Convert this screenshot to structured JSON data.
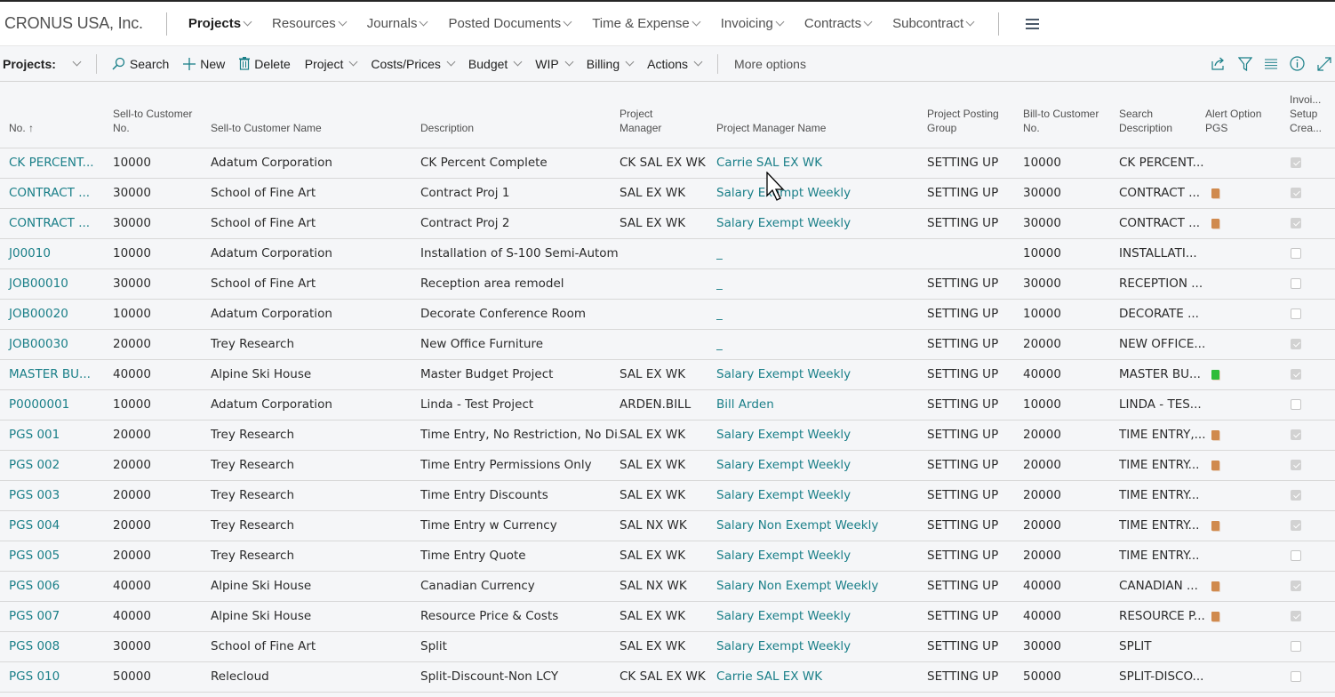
{
  "app": {
    "company": "CRONUS USA, Inc.",
    "nav": [
      {
        "label": "Projects",
        "active": true
      },
      {
        "label": "Resources"
      },
      {
        "label": "Journals"
      },
      {
        "label": "Posted Documents"
      },
      {
        "label": "Time & Expense"
      },
      {
        "label": "Invoicing"
      },
      {
        "label": "Contracts"
      },
      {
        "label": "Subcontract"
      }
    ],
    "menu_icon": "hamburger-icon"
  },
  "toolbar": {
    "title": "Projects:",
    "search_label": "Search",
    "new_label": "New",
    "delete_label": "Delete",
    "project_label": "Project",
    "costs_prices_label": "Costs/Prices",
    "budget_label": "Budget",
    "wip_label": "WIP",
    "billing_label": "Billing",
    "actions_label": "Actions",
    "more_options_label": "More options",
    "right_icons": [
      "share-icon",
      "filter-icon",
      "list-view-icon",
      "info-icon",
      "expand-icon"
    ]
  },
  "colors": {
    "link": "#1a7f88",
    "alert_orange": "#d08a4e",
    "alert_green": "#2ebd3a"
  },
  "table": {
    "columns": [
      "No. ↑",
      "Sell-to Customer No.",
      "Sell-to Customer Name",
      "Description",
      "Project Manager",
      "Project Manager Name",
      "Project Posting Group",
      "Bill-to Customer No.",
      "Search Description",
      "Alert Option PGS",
      "Invoi... Setup Crea..."
    ],
    "rows": [
      {
        "no": "CK PERCENT...",
        "sell_no": "10000",
        "sell_name": "Adatum Corporation",
        "desc": "CK Percent Complete",
        "pm": "CK SAL EX WK",
        "pm_name": "Carrie SAL EX WK",
        "posting": "SETTING UP",
        "bill_no": "10000",
        "search": "CK PERCENT...",
        "alert": "",
        "invoiced": true
      },
      {
        "no": "CONTRACT ...",
        "sell_no": "30000",
        "sell_name": "School of Fine Art",
        "desc": "Contract Proj 1",
        "pm": "SAL EX WK",
        "pm_name": "Salary Exempt Weekly",
        "posting": "SETTING UP",
        "bill_no": "30000",
        "search": "CONTRACT ...",
        "alert": "orange",
        "invoiced": true
      },
      {
        "no": "CONTRACT ...",
        "sell_no": "30000",
        "sell_name": "School of Fine Art",
        "desc": "Contract Proj 2",
        "pm": "SAL EX WK",
        "pm_name": "Salary Exempt Weekly",
        "posting": "SETTING UP",
        "bill_no": "30000",
        "search": "CONTRACT ...",
        "alert": "orange",
        "invoiced": true
      },
      {
        "no": "J00010",
        "sell_no": "10000",
        "sell_name": "Adatum Corporation",
        "desc": "Installation of S-100 Semi-Autom...",
        "pm": "",
        "pm_name": "_",
        "posting": "",
        "bill_no": "10000",
        "search": "INSTALLATI...",
        "alert": "",
        "invoiced": false
      },
      {
        "no": "JOB00010",
        "sell_no": "30000",
        "sell_name": "School of Fine Art",
        "desc": "Reception area remodel",
        "pm": "",
        "pm_name": "_",
        "posting": "SETTING UP",
        "bill_no": "30000",
        "search": "RECEPTION ...",
        "alert": "",
        "invoiced": false
      },
      {
        "no": "JOB00020",
        "sell_no": "10000",
        "sell_name": "Adatum Corporation",
        "desc": "Decorate Conference Room",
        "pm": "",
        "pm_name": "_",
        "posting": "SETTING UP",
        "bill_no": "10000",
        "search": "DECORATE ...",
        "alert": "",
        "invoiced": false
      },
      {
        "no": "JOB00030",
        "sell_no": "20000",
        "sell_name": "Trey Research",
        "desc": "New Office Furniture",
        "pm": "",
        "pm_name": "_",
        "posting": "SETTING UP",
        "bill_no": "20000",
        "search": "NEW OFFICE...",
        "alert": "",
        "invoiced": true
      },
      {
        "no": "MASTER BU...",
        "sell_no": "40000",
        "sell_name": "Alpine Ski House",
        "desc": "Master Budget Project",
        "pm": "SAL EX WK",
        "pm_name": "Salary Exempt Weekly",
        "posting": "SETTING UP",
        "bill_no": "40000",
        "search": "MASTER BU...",
        "alert": "green",
        "invoiced": true
      },
      {
        "no": "P0000001",
        "sell_no": "10000",
        "sell_name": "Adatum Corporation",
        "desc": "Linda - Test Project",
        "pm": "ARDEN.BILL",
        "pm_name": "Bill Arden",
        "posting": "SETTING UP",
        "bill_no": "10000",
        "search": "LINDA - TES...",
        "alert": "",
        "invoiced": false
      },
      {
        "no": "PGS 001",
        "sell_no": "20000",
        "sell_name": "Trey Research",
        "desc": "Time Entry, No Restriction, No Di...",
        "pm": "SAL EX WK",
        "pm_name": "Salary Exempt Weekly",
        "posting": "SETTING UP",
        "bill_no": "20000",
        "search": "TIME ENTRY,...",
        "alert": "orange",
        "invoiced": true
      },
      {
        "no": "PGS 002",
        "sell_no": "20000",
        "sell_name": "Trey Research",
        "desc": "Time Entry Permissions Only",
        "pm": "SAL EX WK",
        "pm_name": "Salary Exempt Weekly",
        "posting": "SETTING UP",
        "bill_no": "20000",
        "search": "TIME ENTRY...",
        "alert": "orange",
        "invoiced": true
      },
      {
        "no": "PGS 003",
        "sell_no": "20000",
        "sell_name": "Trey Research",
        "desc": "Time Entry Discounts",
        "pm": "SAL EX WK",
        "pm_name": "Salary Exempt Weekly",
        "posting": "SETTING UP",
        "bill_no": "20000",
        "search": "TIME ENTRY...",
        "alert": "",
        "invoiced": true
      },
      {
        "no": "PGS 004",
        "sell_no": "20000",
        "sell_name": "Trey Research",
        "desc": "Time Entry w Currency",
        "pm": "SAL NX WK",
        "pm_name": "Salary Non Exempt Weekly",
        "posting": "SETTING UP",
        "bill_no": "20000",
        "search": "TIME ENTRY...",
        "alert": "orange",
        "invoiced": true
      },
      {
        "no": "PGS 005",
        "sell_no": "20000",
        "sell_name": "Trey Research",
        "desc": "Time Entry Quote",
        "pm": "SAL EX WK",
        "pm_name": "Salary Exempt Weekly",
        "posting": "SETTING UP",
        "bill_no": "20000",
        "search": "TIME ENTRY...",
        "alert": "",
        "invoiced": false
      },
      {
        "no": "PGS 006",
        "sell_no": "40000",
        "sell_name": "Alpine Ski House",
        "desc": "Canadian Currency",
        "pm": "SAL NX WK",
        "pm_name": "Salary Non Exempt Weekly",
        "posting": "SETTING UP",
        "bill_no": "40000",
        "search": "CANADIAN ...",
        "alert": "orange",
        "invoiced": true
      },
      {
        "no": "PGS 007",
        "sell_no": "40000",
        "sell_name": "Alpine Ski House",
        "desc": "Resource Price & Costs",
        "pm": "SAL EX WK",
        "pm_name": "Salary Exempt Weekly",
        "posting": "SETTING UP",
        "bill_no": "40000",
        "search": "RESOURCE P...",
        "alert": "orange",
        "invoiced": true
      },
      {
        "no": "PGS 008",
        "sell_no": "30000",
        "sell_name": "School of Fine Art",
        "desc": "Split",
        "pm": "SAL EX WK",
        "pm_name": "Salary Exempt Weekly",
        "posting": "SETTING UP",
        "bill_no": "30000",
        "search": "SPLIT",
        "alert": "",
        "invoiced": false
      },
      {
        "no": "PGS 010",
        "sell_no": "50000",
        "sell_name": "Relecloud",
        "desc": "Split-Discount-Non LCY",
        "pm": "CK SAL EX WK",
        "pm_name": "Carrie SAL EX WK",
        "posting": "SETTING UP",
        "bill_no": "50000",
        "search": "SPLIT-DISCO...",
        "alert": "",
        "invoiced": false
      }
    ]
  }
}
